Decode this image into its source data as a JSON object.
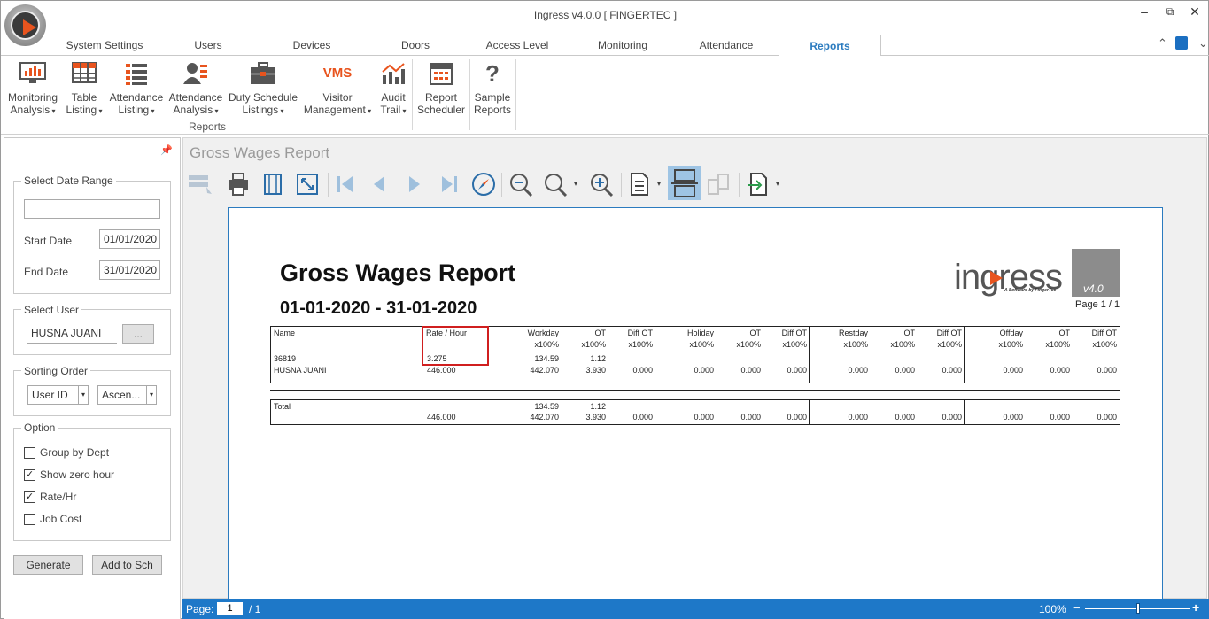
{
  "window": {
    "title": "Ingress v4.0.0 [ FINGERTEC ]"
  },
  "tabs": [
    "System Settings",
    "Users",
    "Devices",
    "Doors",
    "Access Level",
    "Monitoring",
    "Attendance",
    "Reports"
  ],
  "ribbon": {
    "items": [
      {
        "line1": "Monitoring",
        "line2": "Analysis",
        "dropdown": true,
        "icon": "monitor-chart-icon"
      },
      {
        "line1": "Table",
        "line2": "Listing",
        "dropdown": true,
        "icon": "table-icon"
      },
      {
        "line1": "Attendance",
        "line2": "Listing",
        "dropdown": true,
        "icon": "list-icon"
      },
      {
        "line1": "Attendance",
        "line2": "Analysis",
        "dropdown": true,
        "icon": "user-list-icon"
      },
      {
        "line1": "Duty Schedule",
        "line2": "Listings",
        "dropdown": true,
        "icon": "briefcase-icon"
      },
      {
        "line1": "Visitor",
        "line2": "Management",
        "dropdown": true,
        "icon": "vms-icon",
        "icon_text": "VMS"
      },
      {
        "line1": "Audit",
        "line2": "Trail",
        "dropdown": true,
        "icon": "audit-chart-icon"
      },
      {
        "line1": "Report",
        "line2": "Scheduler",
        "dropdown": false,
        "icon": "calendar-icon"
      },
      {
        "line1": "Sample",
        "line2": "Reports",
        "dropdown": false,
        "icon": "question-icon",
        "icon_text": "?"
      }
    ],
    "group_label": "Reports"
  },
  "left_panel": {
    "date_range": {
      "label": "Select Date Range",
      "range_value": "",
      "start_label": "Start Date",
      "start_value": "01/01/2020",
      "end_label": "End Date",
      "end_value": "31/01/2020"
    },
    "select_user": {
      "label": "Select User",
      "value": "HUSNA JUANI",
      "browse": "..."
    },
    "sorting": {
      "label": "Sorting Order",
      "field": "User ID",
      "direction": "Ascen..."
    },
    "option": {
      "label": "Option",
      "items": [
        {
          "label": "Group by Dept",
          "checked": false
        },
        {
          "label": "Show zero hour",
          "checked": true
        },
        {
          "label": "Rate/Hr",
          "checked": true
        },
        {
          "label": "Job Cost",
          "checked": false
        }
      ]
    },
    "generate": "Generate",
    "add_schedule": "Add to Sch"
  },
  "viewer": {
    "title": "Gross Wages Report"
  },
  "report": {
    "title": "Gross Wages Report",
    "range": "01-01-2020 - 31-01-2020",
    "brand": "ingress",
    "brand_sub": "A Software by FingerTec",
    "version": "v4.0",
    "page": "Page 1 / 1",
    "headers": {
      "name": "Name",
      "rate": "Rate / Hour",
      "workday": "Workday",
      "ot": "OT",
      "diff_ot": "Diff OT",
      "holiday": "Holiday",
      "restday": "Restday",
      "offday": "Offday",
      "pct": "x100%"
    },
    "row": {
      "id": "36819",
      "name": "HUSNA JUANI",
      "rate": "3.275",
      "rate_amount": "446.000",
      "workday_hours": "134.59",
      "workday_amount": "442.070",
      "ot_hours": "1.12",
      "ot_amount": "3.930",
      "diff_ot": "0.000",
      "holiday": "0.000",
      "holiday_ot": "0.000",
      "holiday_diff": "0.000",
      "restday": "0.000",
      "restday_ot": "0.000",
      "restday_diff": "0.000",
      "offday": "0.000",
      "offday_ot": "0.000",
      "offday_diff": "0.000"
    },
    "total": {
      "label": "Total",
      "rate_amount": "446.000",
      "workday_hours": "134.59",
      "workday_amount": "442.070",
      "ot_hours": "1.12",
      "ot_amount": "3.930",
      "diff_ot": "0.000",
      "holiday": "0.000",
      "holiday_ot": "0.000",
      "holiday_diff": "0.000",
      "restday": "0.000",
      "restday_ot": "0.000",
      "restday_diff": "0.000",
      "offday": "0.000",
      "offday_ot": "0.000",
      "offday_diff": "0.000"
    }
  },
  "status_bar": {
    "page_label": "Page:",
    "page_value": "1",
    "page_total": "/ 1",
    "zoom": "100%",
    "zoom_fraction": 0.5
  },
  "colors": {
    "accent": "#1e78c8",
    "tab_active": "#2b7bbf",
    "highlight": "#d01f1f",
    "icon_orange": "#e8541e"
  }
}
